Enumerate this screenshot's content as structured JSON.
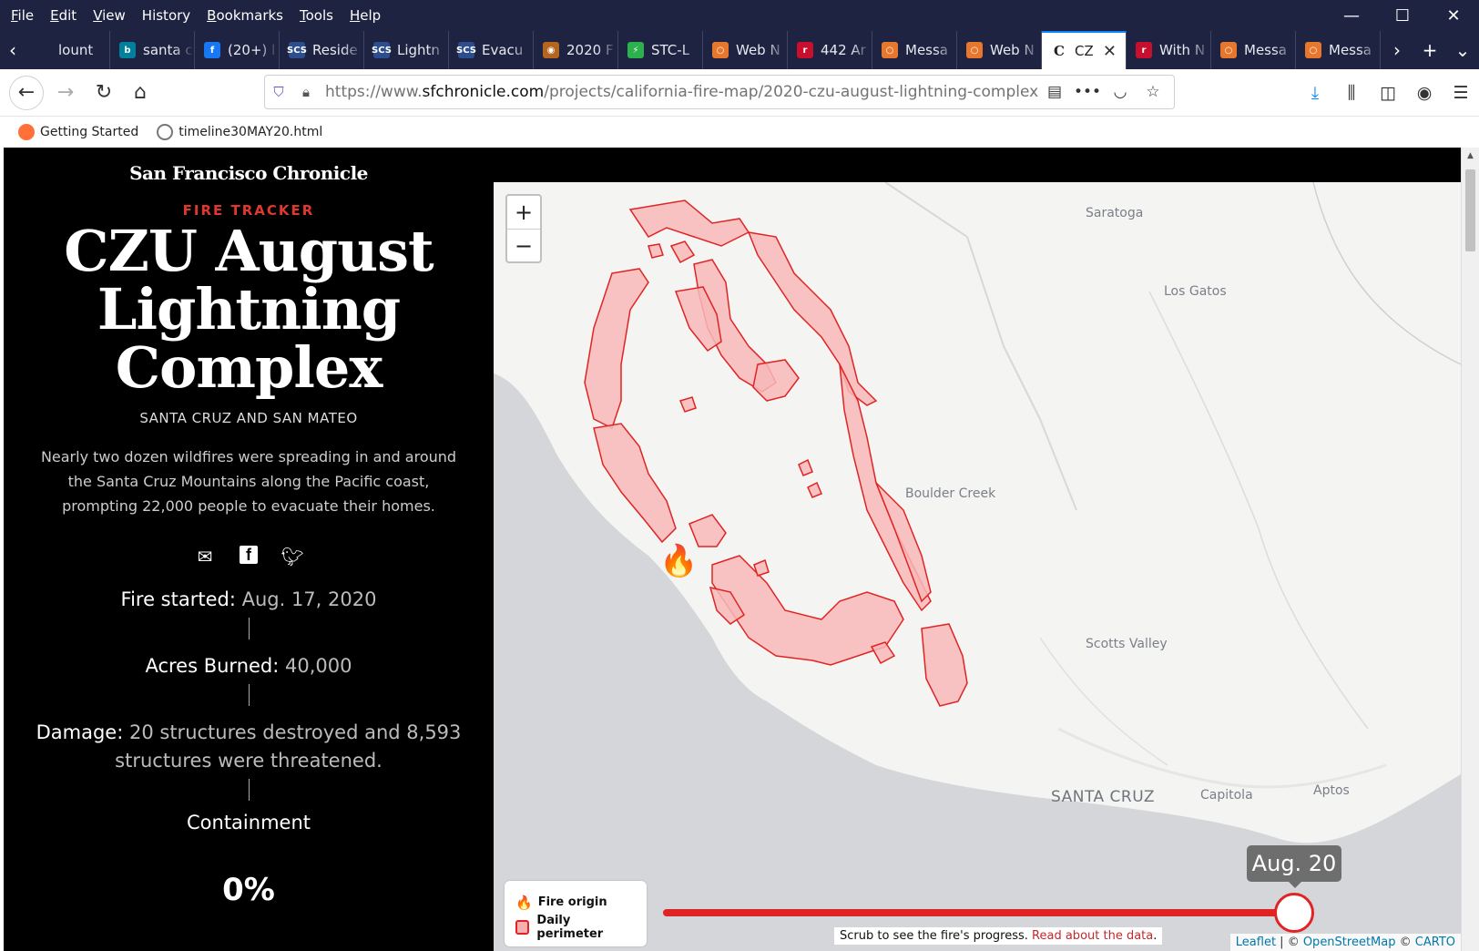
{
  "menubar": {
    "items": [
      {
        "u": "F",
        "rest": "ile"
      },
      {
        "u": "E",
        "rest": "dit"
      },
      {
        "u": "V",
        "rest": "iew"
      },
      {
        "u": "",
        "rest": "History"
      },
      {
        "u": "B",
        "rest": "ookmarks"
      },
      {
        "u": "T",
        "rest": "ools"
      },
      {
        "u": "H",
        "rest": "elp"
      }
    ]
  },
  "tabs": [
    {
      "label": "lount",
      "color": "#1d2340",
      "glyph": ""
    },
    {
      "label": "santa c",
      "color": "#00809d",
      "glyph": "b"
    },
    {
      "label": "(20+) l",
      "color": "#1877f2",
      "glyph": "f"
    },
    {
      "label": "Reside",
      "color": "#2d4e8e",
      "glyph": "SCS"
    },
    {
      "label": "Lightn",
      "color": "#2d4e8e",
      "glyph": "SCS"
    },
    {
      "label": "Evacu",
      "color": "#2d4e8e",
      "glyph": "SCS"
    },
    {
      "label": "2020 F",
      "color": "#b5651d",
      "glyph": "◉"
    },
    {
      "label": "STC-L",
      "color": "#2bb24c",
      "glyph": "⚡"
    },
    {
      "label": "Web N",
      "color": "#e8772e",
      "glyph": "○"
    },
    {
      "label": "442 Ar",
      "color": "#c8102e",
      "glyph": "r"
    },
    {
      "label": "Messa",
      "color": "#e8772e",
      "glyph": "○"
    },
    {
      "label": "Web N",
      "color": "#e8772e",
      "glyph": "○"
    },
    {
      "label": "CZ",
      "color": "#222",
      "glyph": "C",
      "active": true
    },
    {
      "label": "With N",
      "color": "#c8102e",
      "glyph": "r"
    },
    {
      "label": "Messa",
      "color": "#e8772e",
      "glyph": "○"
    },
    {
      "label": "Messa",
      "color": "#e8772e",
      "glyph": "○"
    }
  ],
  "url": {
    "prefix": "https://www.",
    "host": "sfchronicle.com",
    "path": "/projects/california-fire-map/2020-czu-august-lightning-complex"
  },
  "bookmarks": [
    {
      "label": "Getting Started",
      "color": "#ff7139"
    },
    {
      "label": "timeline30MAY20.html",
      "color": "#888"
    }
  ],
  "article": {
    "brand": "San Francisco Chronicle",
    "kicker": "FIRE TRACKER",
    "title_lines": [
      "CZU August",
      "Lightning",
      "Complex"
    ],
    "subtitle": "SANTA CRUZ AND SAN MATEO",
    "description": "Nearly two dozen wildfires were spreading in and around the Santa Cruz Mountains along the Pacific coast, prompting 22,000 people to evacuate their homes.",
    "fire_started_label": "Fire started:",
    "fire_started_value": "Aug. 17, 2020",
    "acres_label": "Acres Burned:",
    "acres_value": "40,000",
    "damage_label": "Damage:",
    "damage_value": "20 structures destroyed and 8,593 structures were threatened.",
    "containment_label": "Containment",
    "containment_value": "0%"
  },
  "map": {
    "zoom_in": "+",
    "zoom_out": "−",
    "places": {
      "saratoga": "Saratoga",
      "los_gatos": "Los Gatos",
      "boulder_creek": "Boulder Creek",
      "scotts_valley": "Scotts Valley",
      "santa_cruz": "SANTA CRUZ",
      "capitola": "Capitola",
      "aptos": "Aptos"
    },
    "legend": {
      "origin": "Fire origin",
      "perimeter": "Daily perimeter"
    },
    "slider_date": "Aug. 20",
    "slider_progress": 1.0,
    "scrub_text": "Scrub to see the fire's progress.",
    "scrub_link": "Read about the data",
    "attribution": {
      "leaflet": "Leaflet",
      "osm": "OpenStreetMap",
      "carto": "CARTO"
    },
    "fire_color": "#e02424"
  }
}
